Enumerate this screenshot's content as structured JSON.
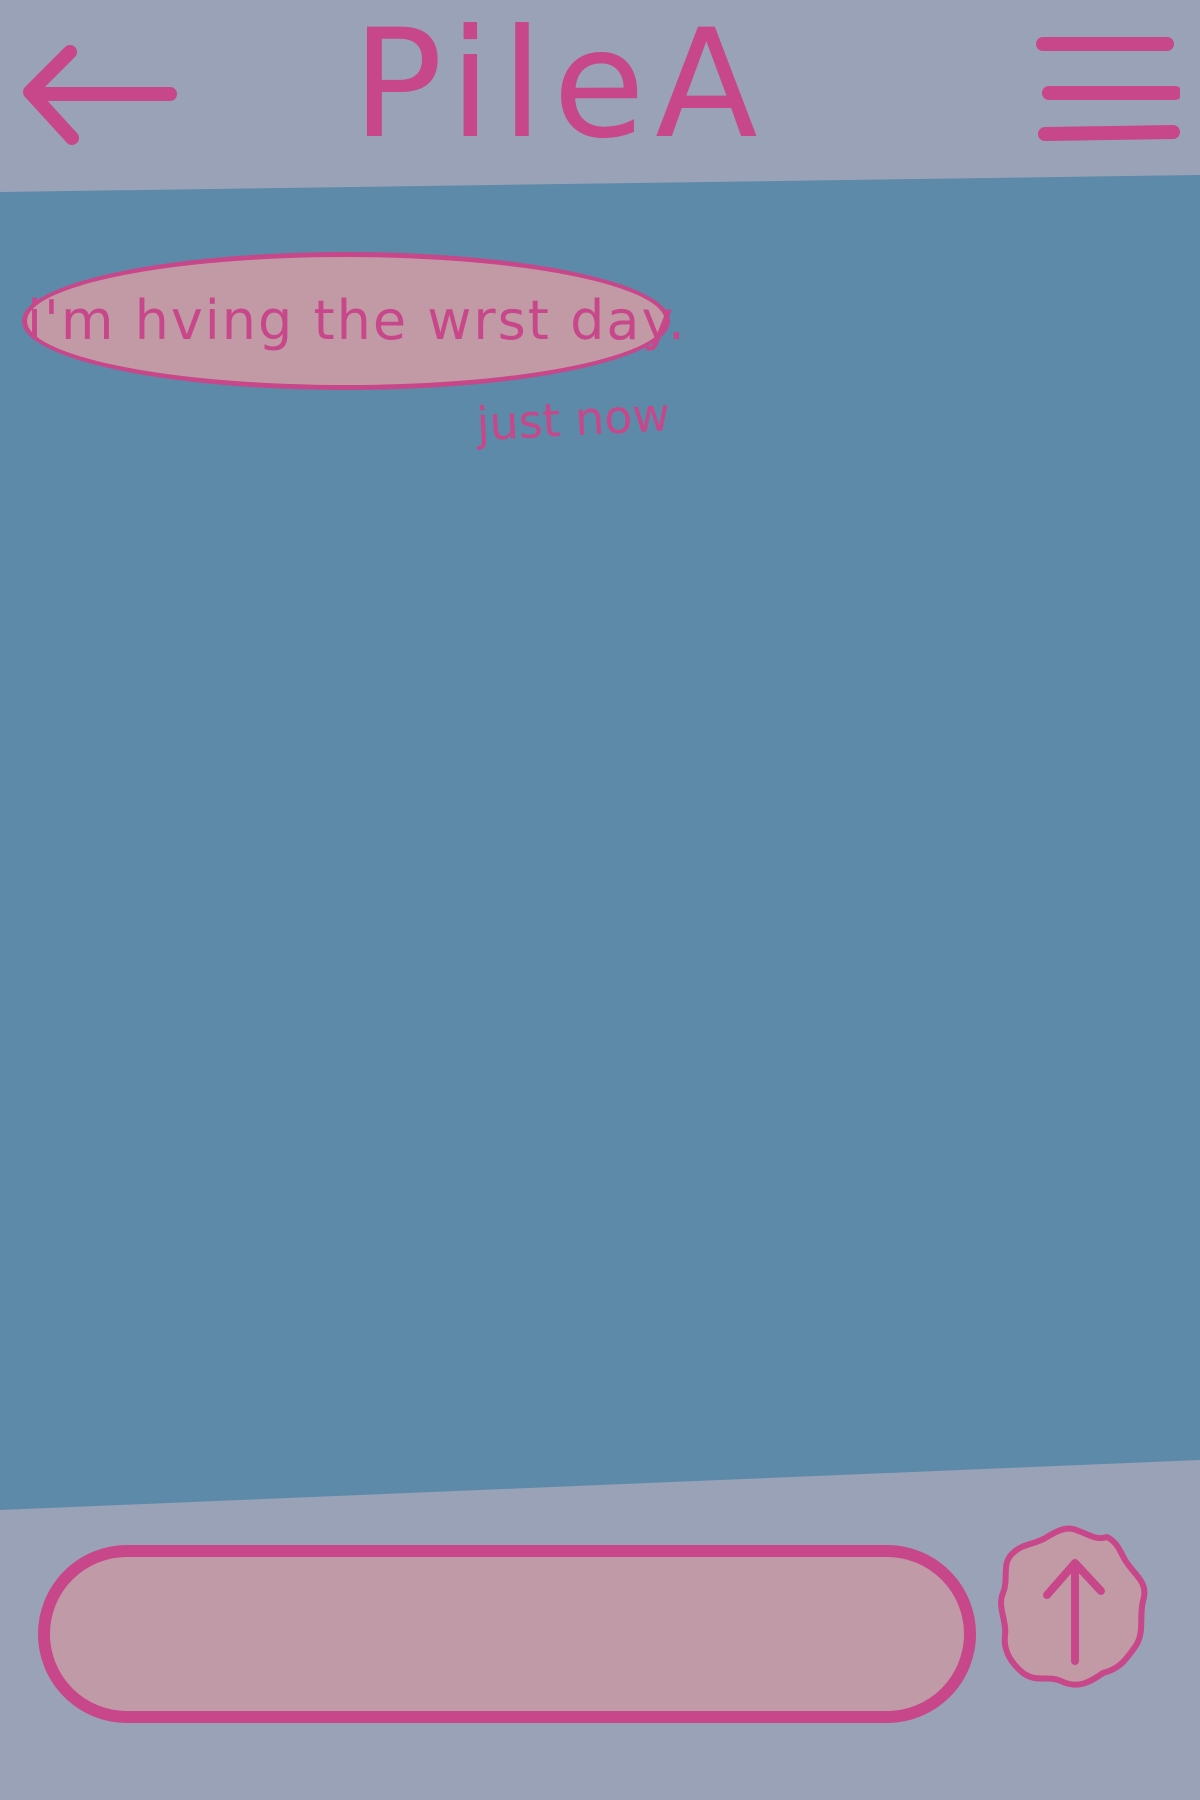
{
  "header": {
    "title": "PileA",
    "back_icon": "arrow-left-icon",
    "menu_icon": "hamburger-menu-icon"
  },
  "conversation": {
    "messages": [
      {
        "text": "i'm hving the wrst day.",
        "timestamp": "just now"
      }
    ]
  },
  "composer": {
    "value": "",
    "placeholder": "",
    "send_icon": "arrow-up-icon"
  },
  "colors": {
    "bar_background": "#9aa2b8",
    "chat_background": "#5c8aa8",
    "accent": "#c8468a",
    "bubble_fill": "#c29aa6"
  }
}
